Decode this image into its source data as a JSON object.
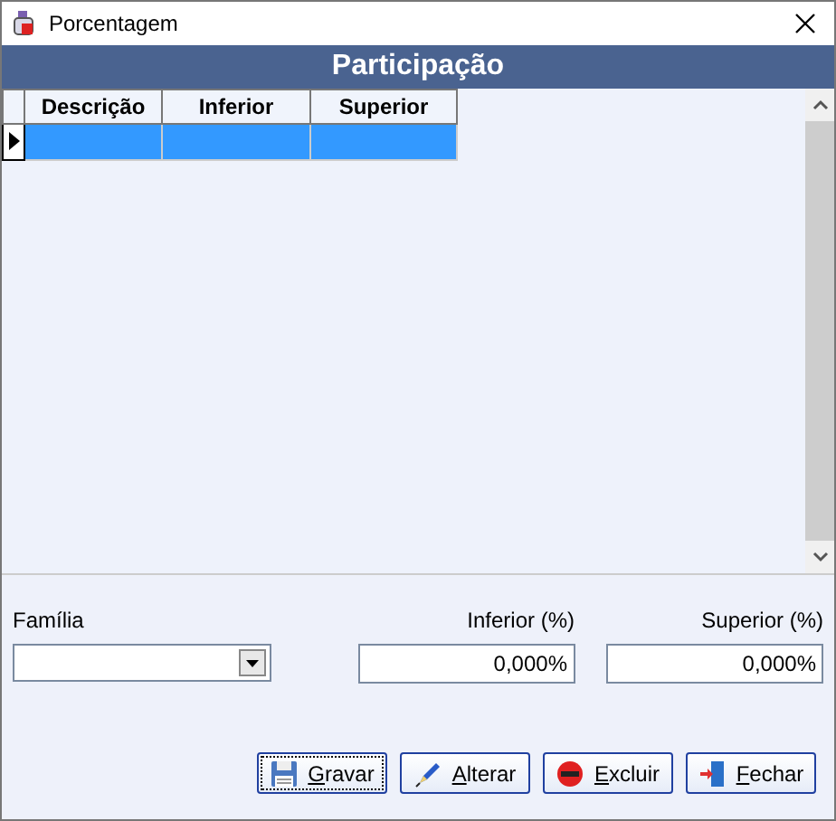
{
  "window": {
    "title": "Porcentagem"
  },
  "panel": {
    "title": "Participação"
  },
  "table": {
    "columns": [
      "Descrição",
      "Inferior",
      "Superior"
    ],
    "rows": [
      {
        "selected": true,
        "cells": [
          "",
          "",
          ""
        ]
      }
    ]
  },
  "form": {
    "fields": [
      {
        "kind": "combo",
        "label": "Família"
      },
      {
        "kind": "text",
        "label": "Inferior (%)",
        "value": "0,000%"
      },
      {
        "kind": "text",
        "label": "Superior (%)",
        "value": "0,000%"
      }
    ]
  },
  "buttons": [
    {
      "label": "Gravar",
      "kind": "save",
      "focused": true
    },
    {
      "label": "Alterar",
      "kind": "edit",
      "focused": false
    },
    {
      "label": "Excluir",
      "kind": "delete",
      "focused": false
    },
    {
      "label": "Fechar",
      "kind": "close",
      "focused": false
    }
  ]
}
